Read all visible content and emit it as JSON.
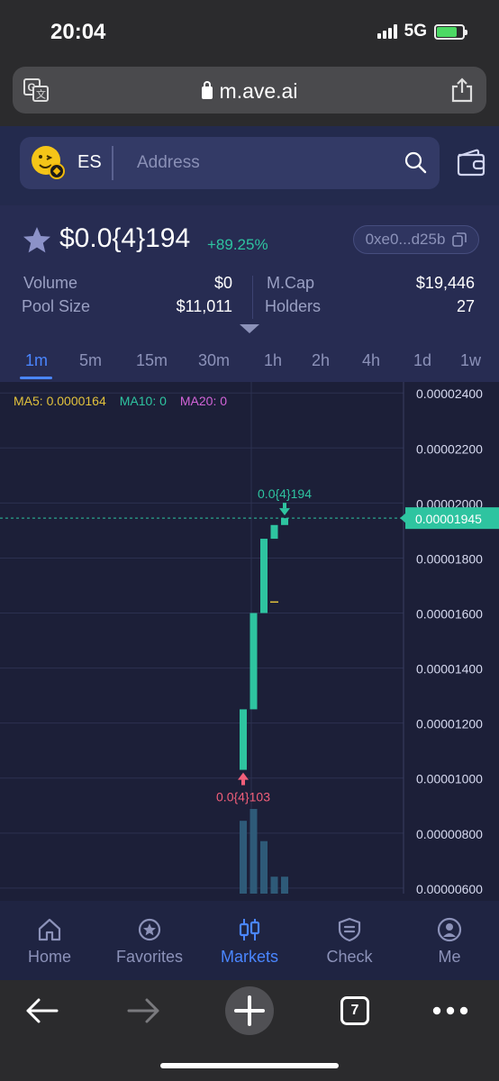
{
  "status_bar": {
    "time": "20:04",
    "network": "5G"
  },
  "browser": {
    "url": "m.ave.ai",
    "tabs_count": "7"
  },
  "header": {
    "chain_label": "ES",
    "search_placeholder": "Address"
  },
  "token": {
    "price": "$0.0{4}194",
    "change": "+89.25%",
    "address_short": "0xe0...d25b",
    "stats": {
      "volume_label": "Volume",
      "volume_value": "$0",
      "pool_label": "Pool Size",
      "pool_value": "$11,011",
      "mcap_label": "M.Cap",
      "mcap_value": "$19,446",
      "holders_label": "Holders",
      "holders_value": "27"
    }
  },
  "timeframes": [
    "1m",
    "5m",
    "15m",
    "30m",
    "1h",
    "2h",
    "4h",
    "1d",
    "1w"
  ],
  "active_timeframe": "1m",
  "ma_legend": {
    "ma5": "MA5: 0.0000164",
    "ma10": "MA10: 0",
    "ma20": "MA20: 0"
  },
  "chart_data": {
    "type": "candlestick",
    "y_ticks": [
      "0.00002400",
      "0.00002200",
      "0.00002000",
      "0.00001800",
      "0.00001600",
      "0.00001400",
      "0.00001200",
      "0.00001000",
      "0.00000800",
      "0.00000600"
    ],
    "y_tick_values": [
      2.4e-05,
      2.2e-05,
      2e-05,
      1.8e-05,
      1.6e-05,
      1.4e-05,
      1.2e-05,
      1e-05,
      8e-06,
      6e-06
    ],
    "y_range": [
      5.8e-06,
      2.44e-05
    ],
    "current_price_label": "0.00001945",
    "current_price": 1.945e-05,
    "high_label": "0.0{4}194",
    "low_label": "0.0{4}103",
    "candles": [
      {
        "open": 1.03e-05,
        "close": 1.25e-05
      },
      {
        "open": 1.25e-05,
        "close": 1.6e-05
      },
      {
        "open": 1.6e-05,
        "close": 1.87e-05
      },
      {
        "open": 1.87e-05,
        "close": 1.92e-05
      },
      {
        "open": 1.92e-05,
        "close": 1.945e-05
      }
    ],
    "volume": [
      0.86,
      1.0,
      0.62,
      0.2,
      0.2
    ],
    "ma5_value": 1.64e-05,
    "colors": {
      "up": "#2ec4a0",
      "down": "#f25f7a",
      "ma5": "#e2c23c",
      "volume": "#2e5a78"
    }
  },
  "nav": [
    {
      "label": "Home",
      "icon": "home-icon"
    },
    {
      "label": "Favorites",
      "icon": "favorites-icon"
    },
    {
      "label": "Markets",
      "icon": "markets-icon"
    },
    {
      "label": "Check",
      "icon": "check-icon"
    },
    {
      "label": "Me",
      "icon": "me-icon"
    }
  ],
  "active_nav": "Markets"
}
